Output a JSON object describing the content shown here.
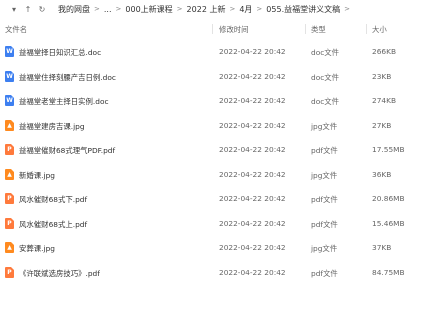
{
  "toolbar": {
    "nav_down": "▾",
    "nav_up": "↑",
    "refresh": "↻",
    "crumbs": [
      "我的网盘",
      "...",
      "000上新课程",
      "2022 上新",
      "4月",
      "055.益福堂讲义文稿"
    ],
    "sep": ">"
  },
  "header": {
    "name": "文件名",
    "date": "修改时间",
    "type": "类型",
    "size": "大小"
  },
  "files": [
    {
      "name": "益福堂择日知识汇总.doc",
      "date": "2022-04-22 20:42",
      "type": "doc文件",
      "size": "266KB",
      "kind": "doc"
    },
    {
      "name": "益福堂住择刻腰产吉日例.doc",
      "date": "2022-04-22 20:42",
      "type": "doc文件",
      "size": "23KB",
      "kind": "doc"
    },
    {
      "name": "益福堂老堂主择日实例.doc",
      "date": "2022-04-22 20:42",
      "type": "doc文件",
      "size": "274KB",
      "kind": "doc"
    },
    {
      "name": "益福堂建房吉课.jpg",
      "date": "2022-04-22 20:42",
      "type": "jpg文件",
      "size": "27KB",
      "kind": "jpg"
    },
    {
      "name": "益福堂催财68式理气PDF.pdf",
      "date": "2022-04-22 20:42",
      "type": "pdf文件",
      "size": "17.55MB",
      "kind": "pdf"
    },
    {
      "name": "新婚课.jpg",
      "date": "2022-04-22 20:42",
      "type": "jpg文件",
      "size": "36KB",
      "kind": "jpg"
    },
    {
      "name": "风水催财68式下.pdf",
      "date": "2022-04-22 20:42",
      "type": "pdf文件",
      "size": "20.86MB",
      "kind": "pdf"
    },
    {
      "name": "风水催财68式上.pdf",
      "date": "2022-04-22 20:42",
      "type": "pdf文件",
      "size": "15.46MB",
      "kind": "pdf"
    },
    {
      "name": "安葬课.jpg",
      "date": "2022-04-22 20:42",
      "type": "jpg文件",
      "size": "37KB",
      "kind": "jpg"
    },
    {
      "name": "《许联斌选房技巧》.pdf",
      "date": "2022-04-22 20:42",
      "type": "pdf文件",
      "size": "84.75MB",
      "kind": "pdf"
    }
  ],
  "icon_colors": {
    "doc": "#3d7ff0",
    "jpg": "#ff8a1f",
    "pdf": "#ff7a3c"
  },
  "icon_glyphs": {
    "doc": "W",
    "jpg": "▲",
    "pdf": "P"
  }
}
